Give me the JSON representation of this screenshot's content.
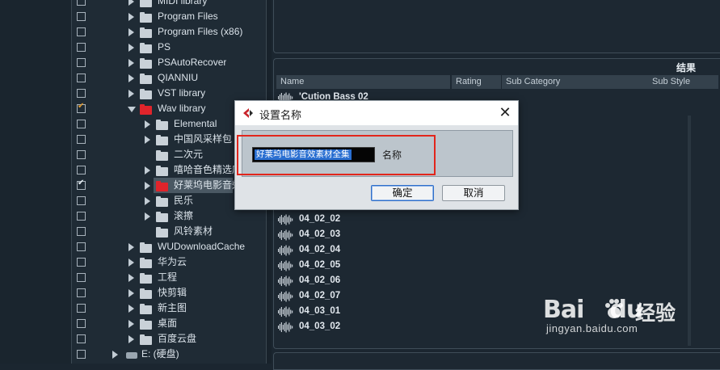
{
  "tree": {
    "items": [
      {
        "label": "MIDI library",
        "level": 0,
        "checked": false,
        "expanded": false,
        "icon": "folder-icon"
      },
      {
        "label": "Program Files",
        "level": 0,
        "checked": false,
        "expanded": false,
        "icon": "folder-icon"
      },
      {
        "label": "Program Files (x86)",
        "level": 0,
        "checked": false,
        "expanded": false,
        "icon": "folder-icon"
      },
      {
        "label": "PS",
        "level": 0,
        "checked": false,
        "expanded": false,
        "icon": "folder-icon"
      },
      {
        "label": "PSAutoRecover",
        "level": 0,
        "checked": false,
        "expanded": false,
        "icon": "folder-icon"
      },
      {
        "label": "QIANNIU",
        "level": 0,
        "checked": false,
        "expanded": false,
        "icon": "folder-icon"
      },
      {
        "label": "VST library",
        "level": 0,
        "checked": false,
        "expanded": false,
        "icon": "folder-icon"
      },
      {
        "label": "Wav library",
        "level": 0,
        "checked": true,
        "expanded": true,
        "icon": "folder-red-icon"
      },
      {
        "label": "Elemental",
        "level": 1,
        "checked": false,
        "expanded": false,
        "icon": "folder-icon"
      },
      {
        "label": "中国风采样包",
        "level": 1,
        "checked": false,
        "expanded": false,
        "icon": "folder-icon"
      },
      {
        "label": "二次元",
        "level": 1,
        "checked": false,
        "expanded": false,
        "icon": "folder-icon"
      },
      {
        "label": "嘻哈音色精选库",
        "level": 1,
        "checked": false,
        "expanded": false,
        "icon": "folder-icon"
      },
      {
        "label": "好莱坞电影音效",
        "level": 1,
        "checked": true,
        "expanded": false,
        "icon": "folder-red-icon"
      },
      {
        "label": "民乐",
        "level": 1,
        "checked": false,
        "expanded": false,
        "icon": "folder-icon"
      },
      {
        "label": "滚擦",
        "level": 1,
        "checked": false,
        "expanded": false,
        "icon": "folder-icon"
      },
      {
        "label": "风铃素材",
        "level": 1,
        "checked": false,
        "expanded": false,
        "icon": "folder-icon"
      },
      {
        "label": "WUDownloadCache",
        "level": 0,
        "checked": false,
        "expanded": false,
        "icon": "folder-icon"
      },
      {
        "label": "华为云",
        "level": 0,
        "checked": false,
        "expanded": false,
        "icon": "folder-icon"
      },
      {
        "label": "工程",
        "level": 0,
        "checked": false,
        "expanded": false,
        "icon": "folder-icon"
      },
      {
        "label": "快剪辑",
        "level": 0,
        "checked": false,
        "expanded": false,
        "icon": "folder-icon"
      },
      {
        "label": "新主图",
        "level": 0,
        "checked": false,
        "expanded": false,
        "icon": "folder-icon"
      },
      {
        "label": "桌面",
        "level": 0,
        "checked": false,
        "expanded": false,
        "icon": "folder-icon"
      },
      {
        "label": "百度云盘",
        "level": 0,
        "checked": false,
        "expanded": false,
        "icon": "folder-icon"
      },
      {
        "label": "E: (硬盘)",
        "level": -1,
        "checked": false,
        "expanded": false,
        "icon": "drive-icon"
      }
    ]
  },
  "results": {
    "title": "结果",
    "columns": [
      "Name",
      "Rating",
      "Sub Category",
      "Sub Style"
    ],
    "rows": [
      "'Cution Bass 02",
      "04_02_02",
      "04_02_03",
      "04_02_04",
      "04_02_05",
      "04_02_06",
      "04_02_07",
      "04_03_01",
      "04_03_02"
    ]
  },
  "dialog": {
    "title": "设置名称",
    "input_value": "好莱坞电影音效素材全集",
    "name_label": "名称",
    "ok_label": "确定",
    "cancel_label": "取消",
    "close_glyph": "✕",
    "highlight_color": "#e2261c"
  },
  "watermark": {
    "logo": "Bai",
    "logo_tail": "du",
    "text": "经验",
    "url": "jingyan.baidu.com"
  }
}
